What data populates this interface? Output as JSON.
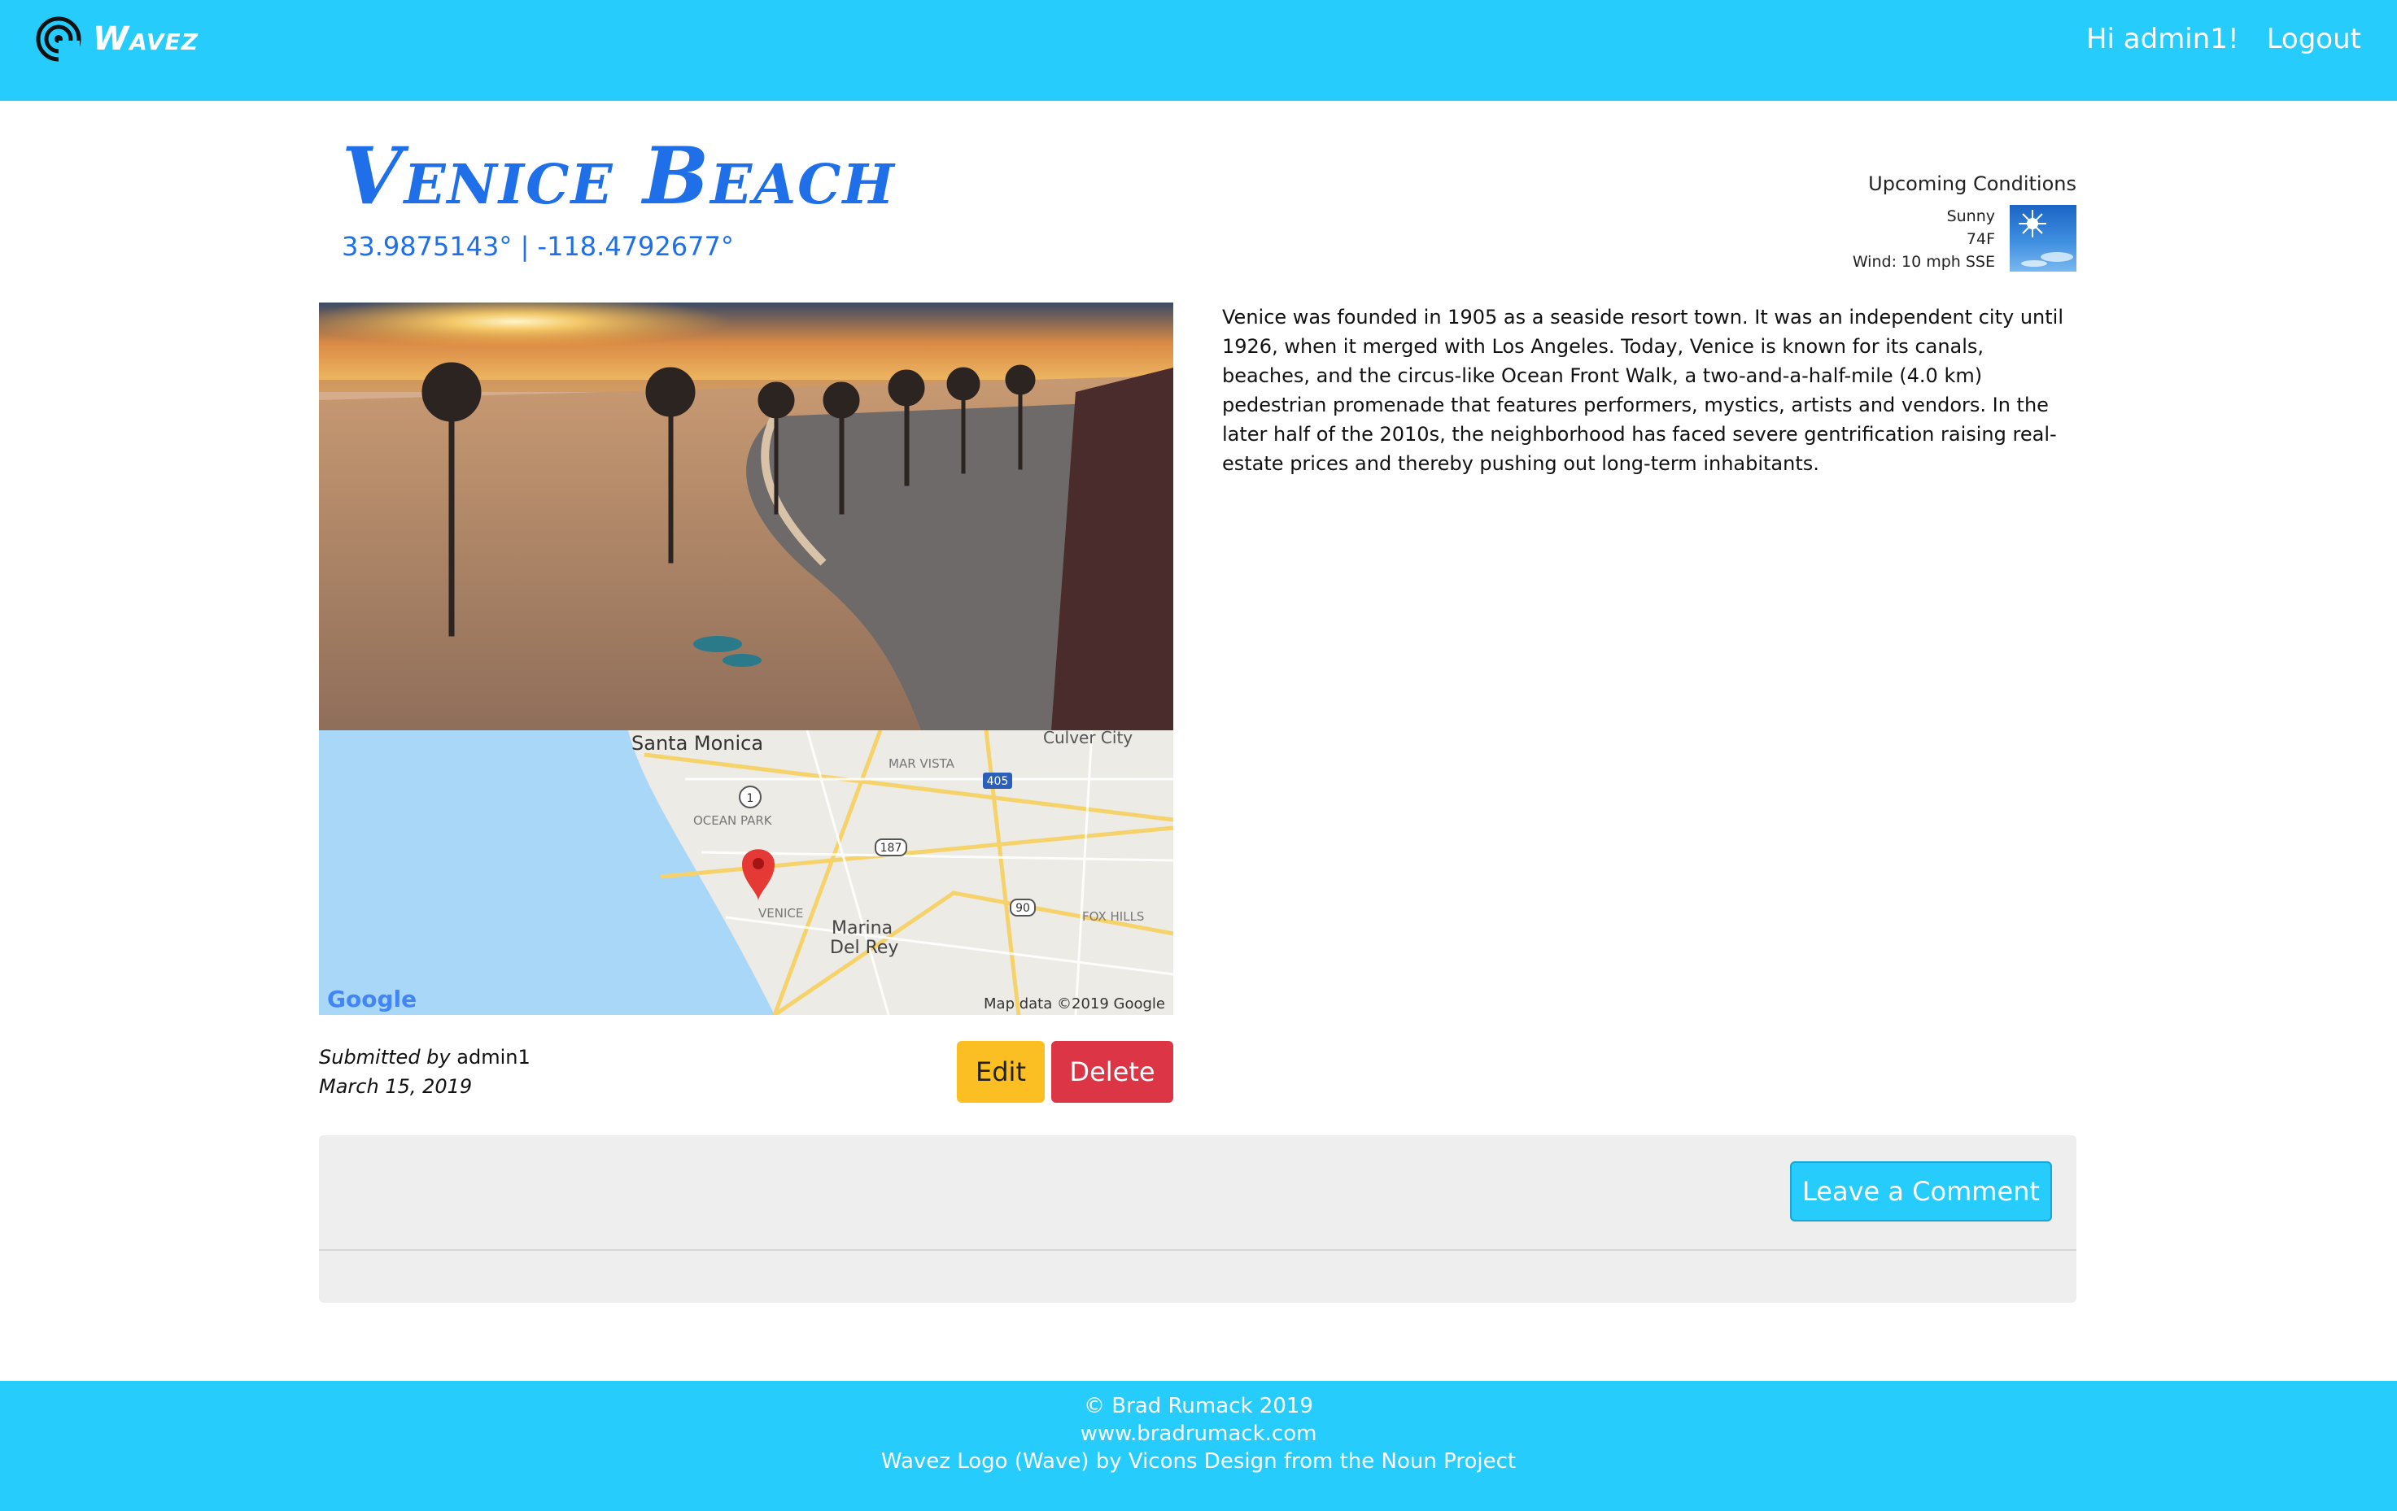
{
  "nav": {
    "brand": "Wavez",
    "greeting": "Hi admin1!",
    "logout": "Logout"
  },
  "spot": {
    "title": "Venice Beach",
    "coords": "33.9875143° | -118.4792677°",
    "description": "Venice was founded in 1905 as a seaside resort town. It was an independent city until 1926, when it merged with Los Angeles. Today, Venice is known for its canals, beaches, and the circus-like Ocean Front Walk, a two-and-a-half-mile (4.0 km) pedestrian promenade that features performers, mystics, artists and vendors. In the later half of the 2010s, the neighborhood has faced severe gentrification raising real-estate prices and thereby pushing out long-term inhabitants.",
    "submitted_prefix": "Submitted by",
    "submitted_user": "admin1",
    "date": "March 15, 2019"
  },
  "conditions": {
    "title": "Upcoming Conditions",
    "summary": "Sunny",
    "temp": "74F",
    "wind": "Wind: 10 mph SSE",
    "icon": "sunny-weather-icon"
  },
  "map": {
    "labels": {
      "santa_monica": "Santa Monica",
      "culver_city": "Culver City",
      "mar_vista": "MAR VISTA",
      "ocean_park": "OCEAN PARK",
      "venice": "VENICE",
      "marina": "Marina",
      "del_rey": "Del Rey",
      "fox_hills": "FOX HILLS",
      "hwy_405": "405",
      "hwy_1": "1",
      "hwy_187": "187",
      "hwy_90": "90",
      "google": "Google",
      "attribution": "Map data ©2019 Google"
    }
  },
  "actions": {
    "edit": "Edit",
    "delete": "Delete",
    "comment": "Leave a Comment"
  },
  "footer": {
    "copyright": "© Brad Rumack 2019",
    "website": "www.bradrumack.com",
    "credit": "Wavez Logo (Wave) by Vicons Design from the Noun Project"
  },
  "colors": {
    "primary": "#26ccfc",
    "title_blue": "#1e6fe8",
    "edit": "#fbbf24",
    "delete": "#dc3545"
  }
}
